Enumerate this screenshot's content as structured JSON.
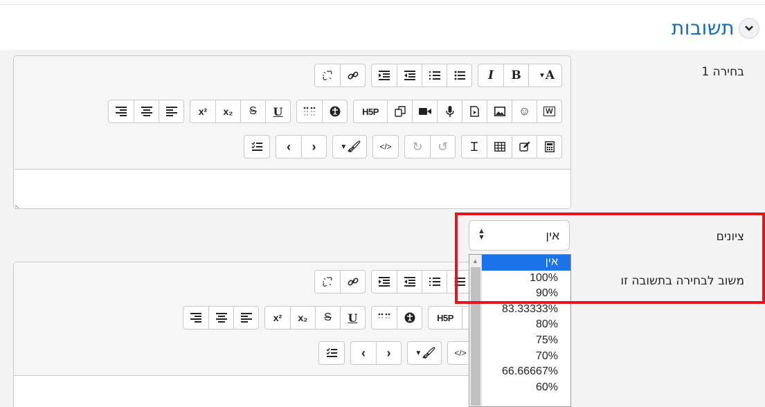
{
  "section": {
    "title": "תשובות",
    "collapse_icon": "chevron-down-icon"
  },
  "choice": {
    "label": "בחירה 1"
  },
  "grade": {
    "label": "ציונים",
    "selected": "אין"
  },
  "feedback": {
    "label": "משוב לבחירה בתשובה זו"
  },
  "dropdown": {
    "options": [
      "אין",
      "100%",
      "90%",
      "83.33333%",
      "80%",
      "75%",
      "70%",
      "66.66667%",
      "60%"
    ],
    "selected_index": 0
  },
  "toolbar": {
    "bold": "B",
    "italic": "I",
    "superscript": "x²",
    "subscript": "x₂",
    "h5p": "H5P",
    "font_color": "A"
  },
  "colors": {
    "accent": "#0f6cbf",
    "highlight": "#e3161d",
    "selected_option": "#1a73e8"
  }
}
